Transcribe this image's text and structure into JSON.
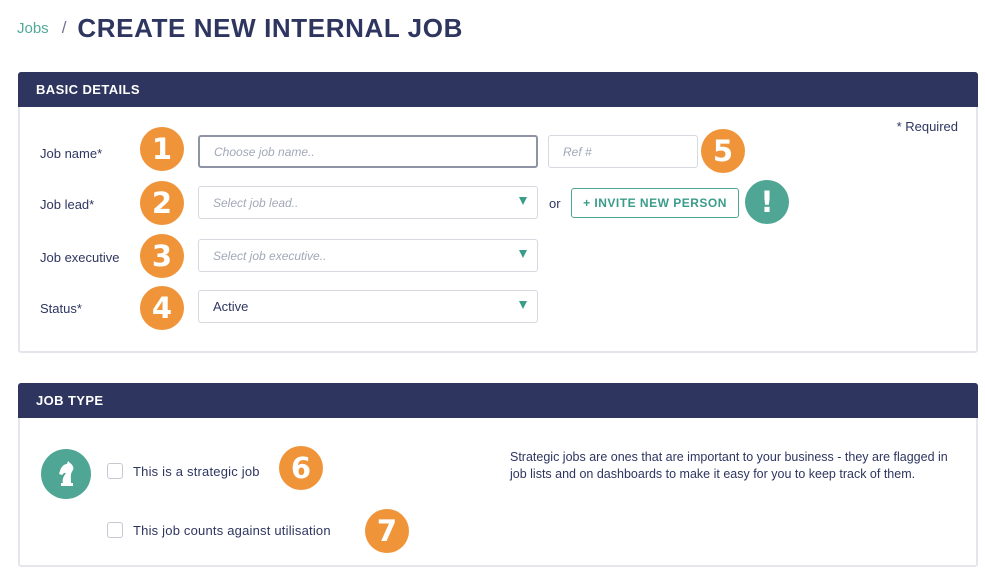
{
  "breadcrumb": {
    "parent": "Jobs",
    "separator": "/",
    "title": "CREATE NEW INTERNAL JOB"
  },
  "basic_details": {
    "header": "BASIC DETAILS",
    "required_note": "* Required",
    "job_name": {
      "label": "Job name*",
      "placeholder": "Choose job name..",
      "badge": "1"
    },
    "ref": {
      "placeholder": "Ref #",
      "badge": "5"
    },
    "job_lead": {
      "label": "Job lead*",
      "placeholder": "Select job lead..",
      "badge": "2"
    },
    "or_text": "or",
    "invite_button": "+ INVITE NEW PERSON",
    "invite_badge": "!",
    "job_executive": {
      "label": "Job executive",
      "placeholder": "Select job executive..",
      "badge": "3"
    },
    "status": {
      "label": "Status*",
      "value": "Active",
      "badge": "4"
    }
  },
  "job_type": {
    "header": "JOB TYPE",
    "strategic_label": "This is a strategic job",
    "strategic_badge": "6",
    "utilisation_label": "This job counts against utilisation",
    "utilisation_badge": "7",
    "help_text": "Strategic jobs are ones that are important to your business - they are flagged in job lists and on dashboards to make it easy for you to keep track of them."
  },
  "colors": {
    "navy": "#2e3660",
    "teal": "#4fa695",
    "orange": "#f0943a"
  }
}
